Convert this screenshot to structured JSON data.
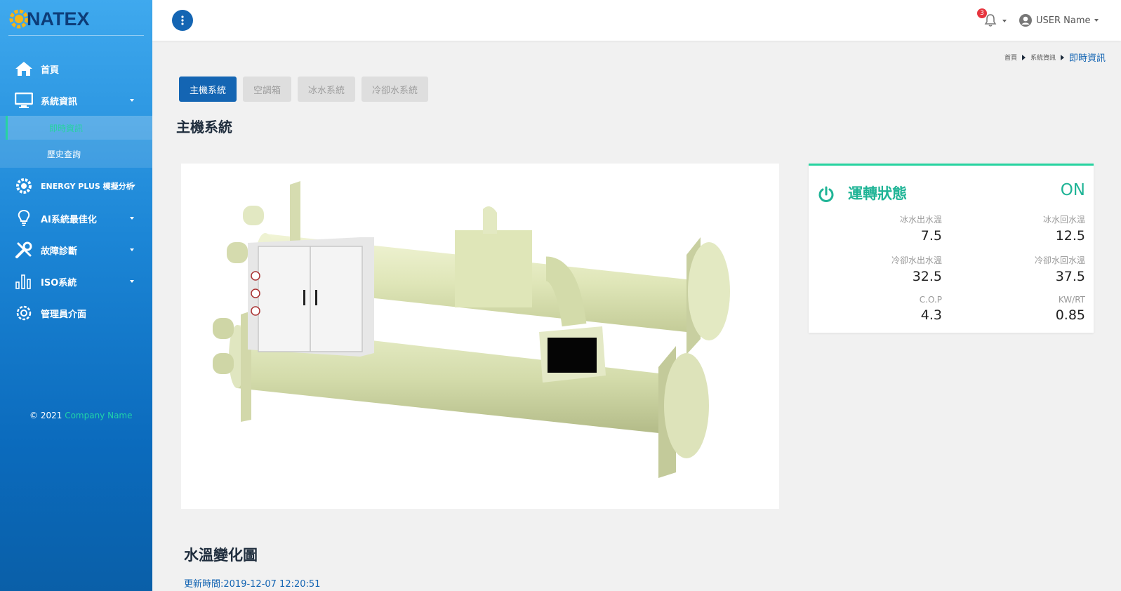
{
  "brand": {
    "logo_text": "NATEX"
  },
  "sidebar": {
    "items": [
      {
        "label": "首頁",
        "icon": "home-icon"
      },
      {
        "label": "系統資訊",
        "icon": "monitor-icon"
      },
      {
        "label": "ENERGY PLUS 模擬分析",
        "icon": "gear-settings-icon"
      },
      {
        "label": "AI系統最佳化",
        "icon": "lightbulb-icon"
      },
      {
        "label": "故障診斷",
        "icon": "tools-icon"
      },
      {
        "label": "ISO系統",
        "icon": "bar-chart-icon"
      },
      {
        "label": "管理員介面",
        "icon": "gear-icon"
      }
    ],
    "submenu": [
      {
        "label": "即時資訊",
        "active": true
      },
      {
        "label": "歷史查詢",
        "active": false
      }
    ],
    "copyright_prefix": "© 2021",
    "copyright_company": "Company Name",
    "colors": {
      "accent": "#27d3a0"
    }
  },
  "topbar": {
    "notification_count": "3",
    "user_name": "USER Name"
  },
  "breadcrumb": {
    "items": [
      "首頁",
      "系統資訊"
    ],
    "current": "即時資訊"
  },
  "tabs": [
    {
      "label": "主機系統",
      "active": true
    },
    {
      "label": "空調箱",
      "active": false
    },
    {
      "label": "冰水系統",
      "active": false
    },
    {
      "label": "冷卻水系統",
      "active": false
    }
  ],
  "page_title": "主機系統",
  "status_card": {
    "title": "運轉狀態",
    "state": "ON",
    "metrics": [
      {
        "label": "冰水出水溫",
        "value": "7.5"
      },
      {
        "label": "冰水回水溫",
        "value": "12.5"
      },
      {
        "label": "冷卻水出水溫",
        "value": "32.5"
      },
      {
        "label": "冷卻水回水溫",
        "value": "37.5"
      },
      {
        "label": "C.O.P",
        "value": "4.3"
      },
      {
        "label": "KW/RT",
        "value": "0.85"
      }
    ]
  },
  "section": {
    "title": "水溫變化圖",
    "update_time": "更新時間:2019-12-07 12:20:51"
  },
  "colors": {
    "primary": "#1465b3",
    "status_green": "#1fb496",
    "badge_red": "#e6353e"
  }
}
